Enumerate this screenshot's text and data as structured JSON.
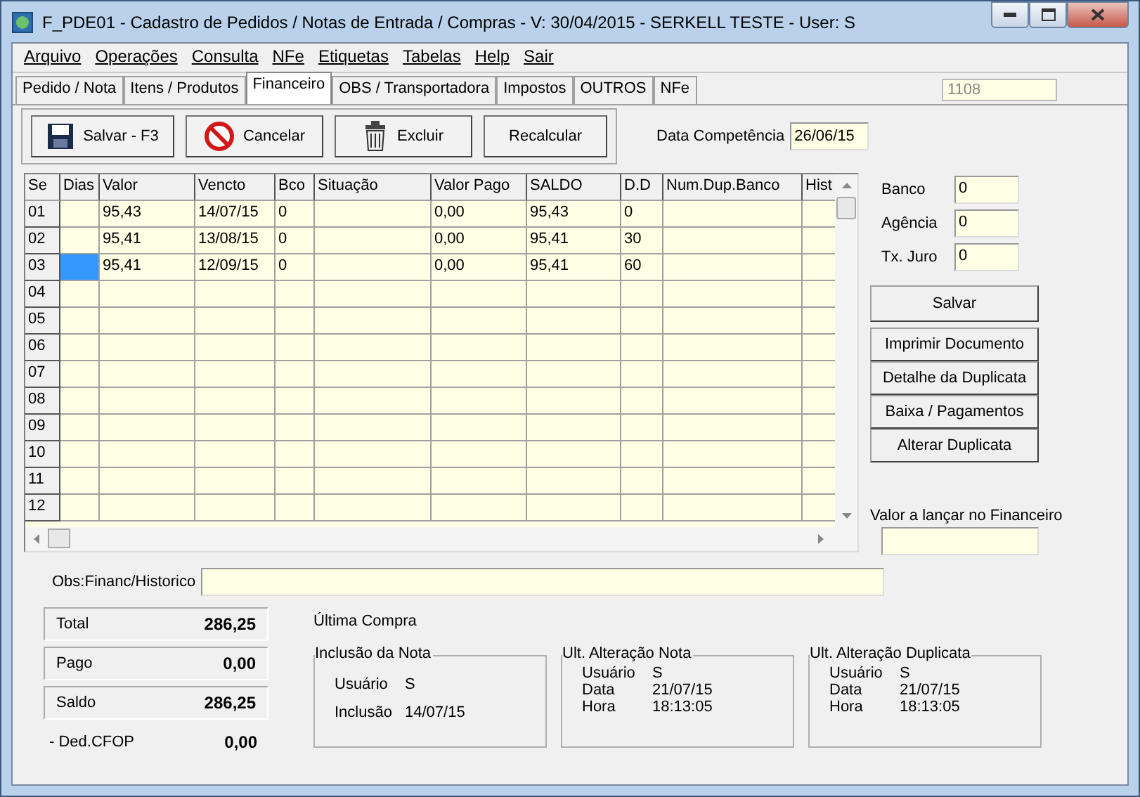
{
  "window": {
    "title": "F_PDE01 - Cadastro de Pedidos / Notas de Entrada / Compras - V: 30/04/2015 - SERKELL TESTE - User: S"
  },
  "menu": [
    "Arquivo",
    "Operações",
    "Consulta",
    "NFe",
    "Etiquetas",
    "Tabelas",
    "Help",
    "Sair"
  ],
  "tabs": [
    {
      "label": "Pedido / Nota",
      "selected": false
    },
    {
      "label": "Itens / Produtos",
      "selected": false
    },
    {
      "label": "Financeiro",
      "selected": true
    },
    {
      "label": "OBS / Transportadora",
      "selected": false
    },
    {
      "label": "Impostos",
      "selected": false
    },
    {
      "label": "OUTROS",
      "selected": false
    },
    {
      "label": "NFe",
      "selected": false
    }
  ],
  "record_number": "1108",
  "toolbar": [
    "Salvar - F3",
    "Cancelar",
    "Excluir",
    "Recalcular"
  ],
  "data_competencia": {
    "label": "Data Competência",
    "value": "26/06/15"
  },
  "table": {
    "columns": [
      "Se",
      "Dias",
      "Valor",
      "Vencto",
      "Bco",
      "Situação",
      "Valor Pago",
      "SALDO",
      "D.D",
      "Num.Dup.Banco",
      "Hist"
    ],
    "rows": [
      {
        "selected": false,
        "cells": [
          "01",
          "",
          "95,43",
          "14/07/15",
          "0",
          "",
          "0,00",
          "95,43",
          "0",
          "",
          ""
        ]
      },
      {
        "selected": false,
        "cells": [
          "02",
          "",
          "95,41",
          "13/08/15",
          "0",
          "",
          "0,00",
          "95,41",
          "30",
          "",
          ""
        ]
      },
      {
        "selected": true,
        "cells": [
          "03",
          "",
          "95,41",
          "12/09/15",
          "0",
          "",
          "0,00",
          "95,41",
          "60",
          "",
          ""
        ]
      },
      {
        "selected": false,
        "cells": [
          "04",
          "",
          "",
          "",
          "",
          "",
          "",
          "",
          "",
          "",
          ""
        ]
      },
      {
        "selected": false,
        "cells": [
          "05",
          "",
          "",
          "",
          "",
          "",
          "",
          "",
          "",
          "",
          ""
        ]
      },
      {
        "selected": false,
        "cells": [
          "06",
          "",
          "",
          "",
          "",
          "",
          "",
          "",
          "",
          "",
          ""
        ]
      },
      {
        "selected": false,
        "cells": [
          "07",
          "",
          "",
          "",
          "",
          "",
          "",
          "",
          "",
          "",
          ""
        ]
      },
      {
        "selected": false,
        "cells": [
          "08",
          "",
          "",
          "",
          "",
          "",
          "",
          "",
          "",
          "",
          ""
        ]
      },
      {
        "selected": false,
        "cells": [
          "09",
          "",
          "",
          "",
          "",
          "",
          "",
          "",
          "",
          "",
          ""
        ]
      },
      {
        "selected": false,
        "cells": [
          "10",
          "",
          "",
          "",
          "",
          "",
          "",
          "",
          "",
          "",
          ""
        ]
      },
      {
        "selected": false,
        "cells": [
          "11",
          "",
          "",
          "",
          "",
          "",
          "",
          "",
          "",
          "",
          ""
        ]
      },
      {
        "selected": false,
        "cells": [
          "12",
          "",
          "",
          "",
          "",
          "",
          "",
          "",
          "",
          "",
          ""
        ]
      }
    ]
  },
  "side_fields": [
    {
      "label": "Banco",
      "value": "0"
    },
    {
      "label": "Agência",
      "value": "0"
    },
    {
      "label": "Tx. Juro",
      "value": "0"
    }
  ],
  "side_save": "Salvar",
  "side_buttons": [
    "Imprimir Documento",
    "Detalhe da Duplicata",
    "Baixa / Pagamentos",
    "Alterar Duplicata"
  ],
  "valor_lancar": {
    "label": "Valor a lançar no Financeiro"
  },
  "obs": {
    "label": "Obs:Financ/Historico"
  },
  "totals": [
    {
      "label": "Total",
      "value": "286,25",
      "kind": "panel"
    },
    {
      "label": "Pago",
      "value": "0,00",
      "kind": "panel"
    },
    {
      "label": "Saldo",
      "value": "286,25",
      "kind": "panel"
    },
    {
      "label": "- Ded.CFOP",
      "value": "0,00",
      "kind": "plain"
    }
  ],
  "ultima_compra": "Última Compra",
  "groups": [
    {
      "title": "Inclusão da Nota",
      "kind": "spaced",
      "rows": [
        {
          "label": "Usuário",
          "value": "S"
        },
        {
          "label": "Inclusão",
          "value": "14/07/15"
        }
      ]
    },
    {
      "title": "Ult. Alteração Nota",
      "kind": "compact",
      "rows": [
        {
          "label": "Usuário",
          "value": "S"
        },
        {
          "label": "Data",
          "value": "21/07/15"
        },
        {
          "label": "Hora",
          "value": "18:13:05"
        }
      ]
    },
    {
      "title": "Ult. Alteração Duplicata",
      "kind": "compact",
      "rows": [
        {
          "label": "Usuário",
          "value": "S"
        },
        {
          "label": "Data",
          "value": "21/07/15"
        },
        {
          "label": "Hora",
          "value": "18:13:05"
        }
      ]
    }
  ]
}
